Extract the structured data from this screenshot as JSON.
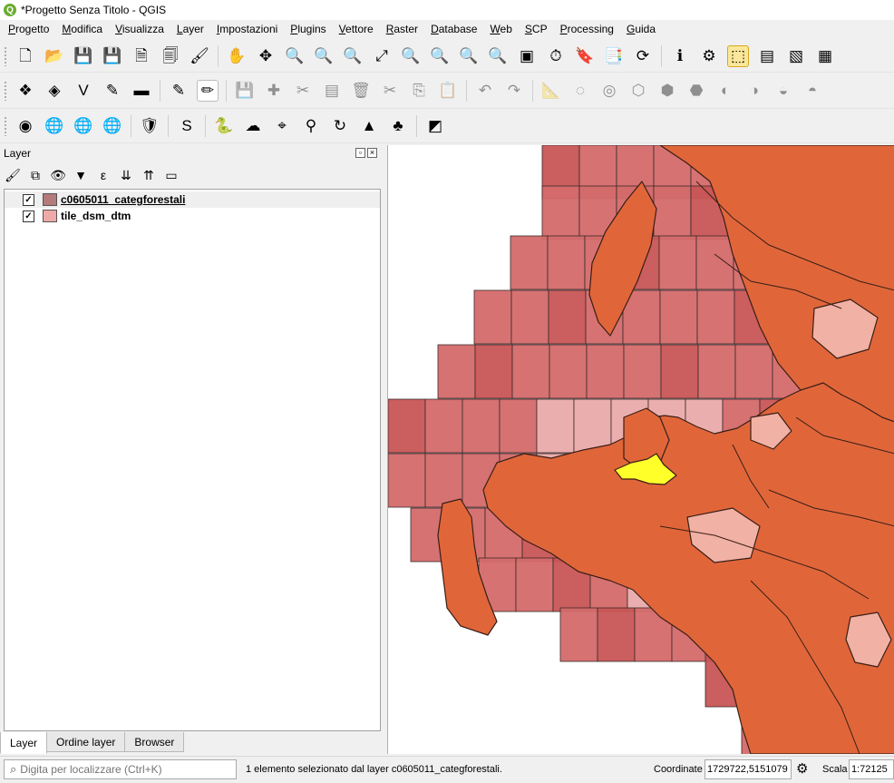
{
  "window": {
    "title": "*Progetto Senza Titolo - QGIS"
  },
  "menu": [
    "Progetto",
    "Modifica",
    "Visualizza",
    "Layer",
    "Impostazioni",
    "Plugins",
    "Vettore",
    "Raster",
    "Database",
    "Web",
    "SCP",
    "Processing",
    "Guida"
  ],
  "toolbar1": [
    {
      "name": "new-project-icon",
      "glyph": "🗋"
    },
    {
      "name": "open-project-icon",
      "glyph": "📂"
    },
    {
      "name": "save-project-icon",
      "glyph": "💾"
    },
    {
      "name": "save-as-icon",
      "glyph": "💾"
    },
    {
      "name": "new-print-layout-icon",
      "glyph": "🗎"
    },
    {
      "name": "layout-manager-icon",
      "glyph": "🗐"
    },
    {
      "name": "style-manager-icon",
      "glyph": "🖌"
    },
    {
      "name": "pan-map-icon",
      "glyph": "✋"
    },
    {
      "name": "pan-to-selection-icon",
      "glyph": "✥"
    },
    {
      "name": "zoom-in-icon",
      "glyph": "🔍"
    },
    {
      "name": "zoom-out-icon",
      "glyph": "🔍"
    },
    {
      "name": "zoom-native-icon",
      "glyph": "🔍"
    },
    {
      "name": "zoom-full-icon",
      "glyph": "⤢"
    },
    {
      "name": "zoom-to-selection-icon",
      "glyph": "🔍"
    },
    {
      "name": "zoom-to-layer-icon",
      "glyph": "🔍"
    },
    {
      "name": "zoom-last-icon",
      "glyph": "🔍"
    },
    {
      "name": "zoom-next-icon",
      "glyph": "🔍"
    },
    {
      "name": "new-map-view-icon",
      "glyph": "▣"
    },
    {
      "name": "temporal-controller-icon",
      "glyph": "⏱"
    },
    {
      "name": "new-bookmark-icon",
      "glyph": "🔖"
    },
    {
      "name": "show-bookmarks-icon",
      "glyph": "📑"
    },
    {
      "name": "refresh-icon",
      "glyph": "⟳"
    },
    {
      "name": "identify-features-icon",
      "glyph": "ℹ"
    },
    {
      "name": "actions-icon",
      "glyph": "⚙"
    },
    {
      "name": "select-features-icon",
      "glyph": "⬚"
    },
    {
      "name": "select-by-value-icon",
      "glyph": "▤"
    },
    {
      "name": "deselect-all-icon",
      "glyph": "▧"
    },
    {
      "name": "attribute-table-icon",
      "glyph": "▦"
    }
  ],
  "toolbar2": [
    {
      "name": "data-source-manager-icon",
      "glyph": "❖"
    },
    {
      "name": "new-geopackage-layer-icon",
      "glyph": "◈"
    },
    {
      "name": "digitize-vertex-icon",
      "glyph": "V"
    },
    {
      "name": "georeferencer-icon",
      "glyph": "✎"
    },
    {
      "name": "gps-icon",
      "glyph": "▬"
    },
    {
      "name": "current-edits-icon",
      "glyph": "✎"
    },
    {
      "name": "toggle-editing-icon",
      "glyph": "✏"
    },
    {
      "name": "save-layer-edits-icon",
      "glyph": "💾"
    },
    {
      "name": "add-feature-icon",
      "glyph": "✚"
    },
    {
      "name": "vertex-tool-icon",
      "glyph": "✂"
    },
    {
      "name": "modify-attributes-icon",
      "glyph": "▤"
    },
    {
      "name": "delete-selected-icon",
      "glyph": "🗑"
    },
    {
      "name": "cut-features-icon",
      "glyph": "✂"
    },
    {
      "name": "copy-features-icon",
      "glyph": "⎘"
    },
    {
      "name": "paste-features-icon",
      "glyph": "📋"
    },
    {
      "name": "undo-icon",
      "glyph": "↶"
    },
    {
      "name": "redo-icon",
      "glyph": "↷"
    },
    {
      "name": "measure-icon",
      "glyph": "📐"
    },
    {
      "name": "add-ring-icon",
      "glyph": "◌"
    },
    {
      "name": "add-part-icon",
      "glyph": "◎"
    },
    {
      "name": "fill-ring-icon",
      "glyph": "⬡"
    },
    {
      "name": "delete-ring-icon",
      "glyph": "⬢"
    },
    {
      "name": "delete-part-icon",
      "glyph": "⬣"
    },
    {
      "name": "reshape-icon",
      "glyph": "◐"
    },
    {
      "name": "offset-curve-icon",
      "glyph": "◑"
    },
    {
      "name": "split-features-icon",
      "glyph": "◒"
    },
    {
      "name": "simplify-icon",
      "glyph": "◓"
    }
  ],
  "toolbar3": [
    {
      "name": "openlayers-icon",
      "glyph": "◉"
    },
    {
      "name": "add-wms-layer-icon",
      "glyph": "🌐"
    },
    {
      "name": "add-wfs-layer-icon",
      "glyph": "🌐"
    },
    {
      "name": "metasearch-icon",
      "glyph": "🌐"
    },
    {
      "name": "shield-plugin-icon",
      "glyph": "🛡"
    },
    {
      "name": "scp-icon",
      "glyph": "S"
    },
    {
      "name": "python-console-icon",
      "glyph": "🐍"
    },
    {
      "name": "cloud-icon",
      "glyph": "☁"
    },
    {
      "name": "coord-capture-icon",
      "glyph": "⌖"
    },
    {
      "name": "geolocation-icon",
      "glyph": "⚲"
    },
    {
      "name": "rotate-icon",
      "glyph": "↻"
    },
    {
      "name": "terrain-icon",
      "glyph": "▲"
    },
    {
      "name": "chm-icon",
      "glyph": "♣"
    },
    {
      "name": "vector-tool-icon",
      "glyph": "◩"
    }
  ],
  "layers_panel": {
    "title": "Layer",
    "layers": [
      {
        "name": "c0605011_categforestali",
        "checked": "✓",
        "color": "#b57a7a",
        "selected": true
      },
      {
        "name": "tile_dsm_dtm",
        "checked": "✓",
        "color": "#f0a9a9",
        "selected": false
      }
    ],
    "tabs": [
      "Layer",
      "Ordine layer",
      "Browser"
    ]
  },
  "status": {
    "locator_placeholder": "Digita per localizzare (Ctrl+K)",
    "message": "1 elemento selezionato dal layer c0605011_categforestali.",
    "coordinate_label": "Coordinate",
    "coordinate_value": "1729722,5151079",
    "scale_label": "Scala",
    "scale_value": "1:72125"
  },
  "colors": {
    "tile": "#d46a6a",
    "tile_dark": "#c85555",
    "tile_light": "#eaaaaa",
    "forest": "#e0663a",
    "selected": "#ffff2a"
  }
}
